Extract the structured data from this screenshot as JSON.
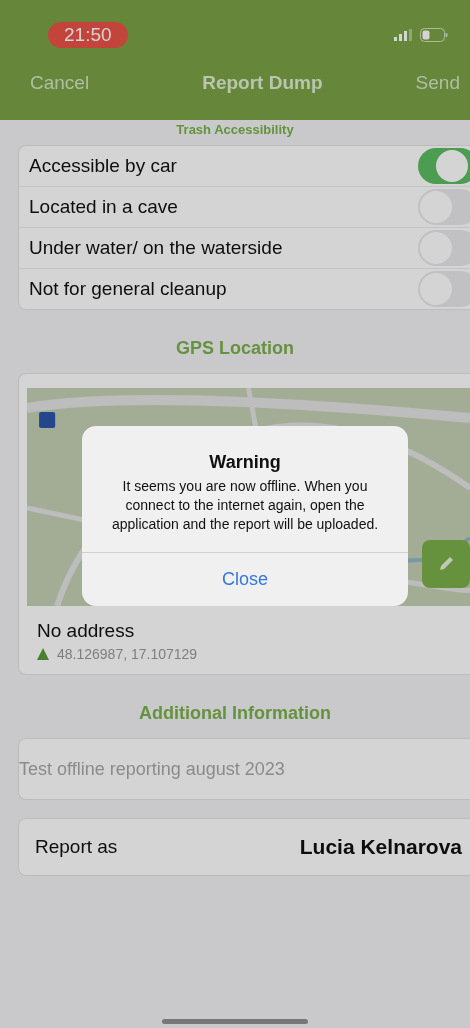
{
  "status_bar": {
    "time": "21:50"
  },
  "nav_bar": {
    "cancel": "Cancel",
    "title": "Report Dump",
    "send": "Send"
  },
  "accessibility": {
    "title": "Trash Accessibility",
    "options": [
      {
        "label": "Accessible by car",
        "on": true
      },
      {
        "label": "Located in a cave",
        "on": false
      },
      {
        "label": "Under water/ on the waterside",
        "on": false
      },
      {
        "label": "Not for general cleanup",
        "on": false
      }
    ]
  },
  "gps": {
    "title": "GPS Location",
    "address": "No address",
    "coordinates": "48.126987, 17.107129"
  },
  "additional": {
    "title": "Additional Information",
    "note": {
      "value": "Test offline reporting august 2023"
    }
  },
  "report_as": {
    "label": "Report as",
    "name": "Lucia Kelnarova"
  },
  "dialog": {
    "title": "Warning",
    "message": "It seems you are now offline. When you connect to the internet again, open the application and the report will be uploaded.",
    "button": "Close"
  }
}
